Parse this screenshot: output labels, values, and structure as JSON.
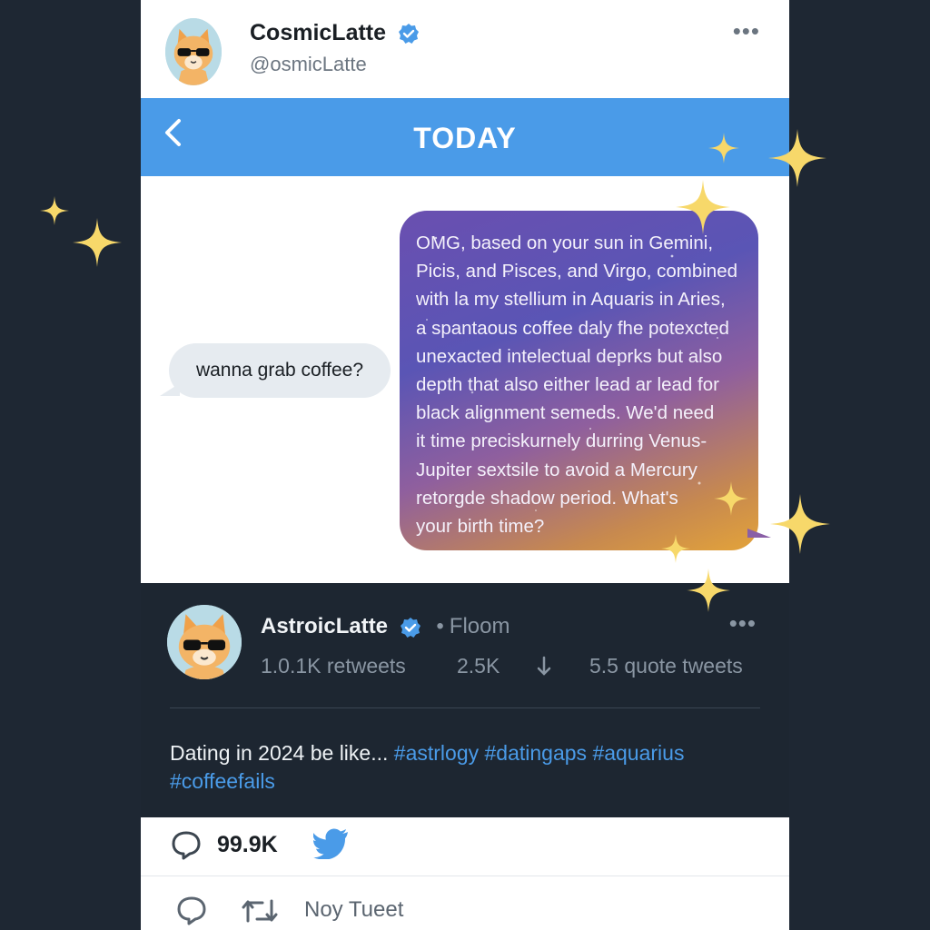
{
  "header": {
    "name": "CosmicLatte",
    "handle": "@osmicLatte"
  },
  "chat_bar": {
    "title": "TODAY",
    "back_icon": "chevron-left-icon"
  },
  "messages": {
    "received": "wanna grab coffee?",
    "sent_lines": [
      "OMG, based on your sun in Gemini,",
      "Picis, and Pisces, and Virgo, combined",
      "with la my stellium in Aquaris in Aries,",
      "a spantaous coffee daly fhe potexcted",
      "unexacted intelectual deprks but also",
      "depth that also either lead ar lead for",
      "black alignment semeds. We'd need",
      "it time preciskurnely durring Venus-",
      "Jupiter sextsile to avoid a Mercury",
      "retorgde shadow period. What's",
      "your birth time?"
    ]
  },
  "tweet": {
    "name": "AstroicLatte",
    "dot": "•",
    "room": "Floom",
    "retweets": "1.0.1K retweets",
    "likes": "2.5K",
    "quotes": "5.5 quote tweets",
    "text": "Dating in 2024 be like...",
    "hashtags": [
      "#astrlogy",
      "#datingaps",
      "#aquarius",
      "#coffeefails"
    ]
  },
  "actions": {
    "reply_count": "99.9K",
    "label": "Noy Tueet"
  },
  "colors": {
    "background": "#1e2733",
    "accent": "#4a9be8",
    "tweet_bg": "#1d2631",
    "sparkle": "#f7d86a"
  }
}
